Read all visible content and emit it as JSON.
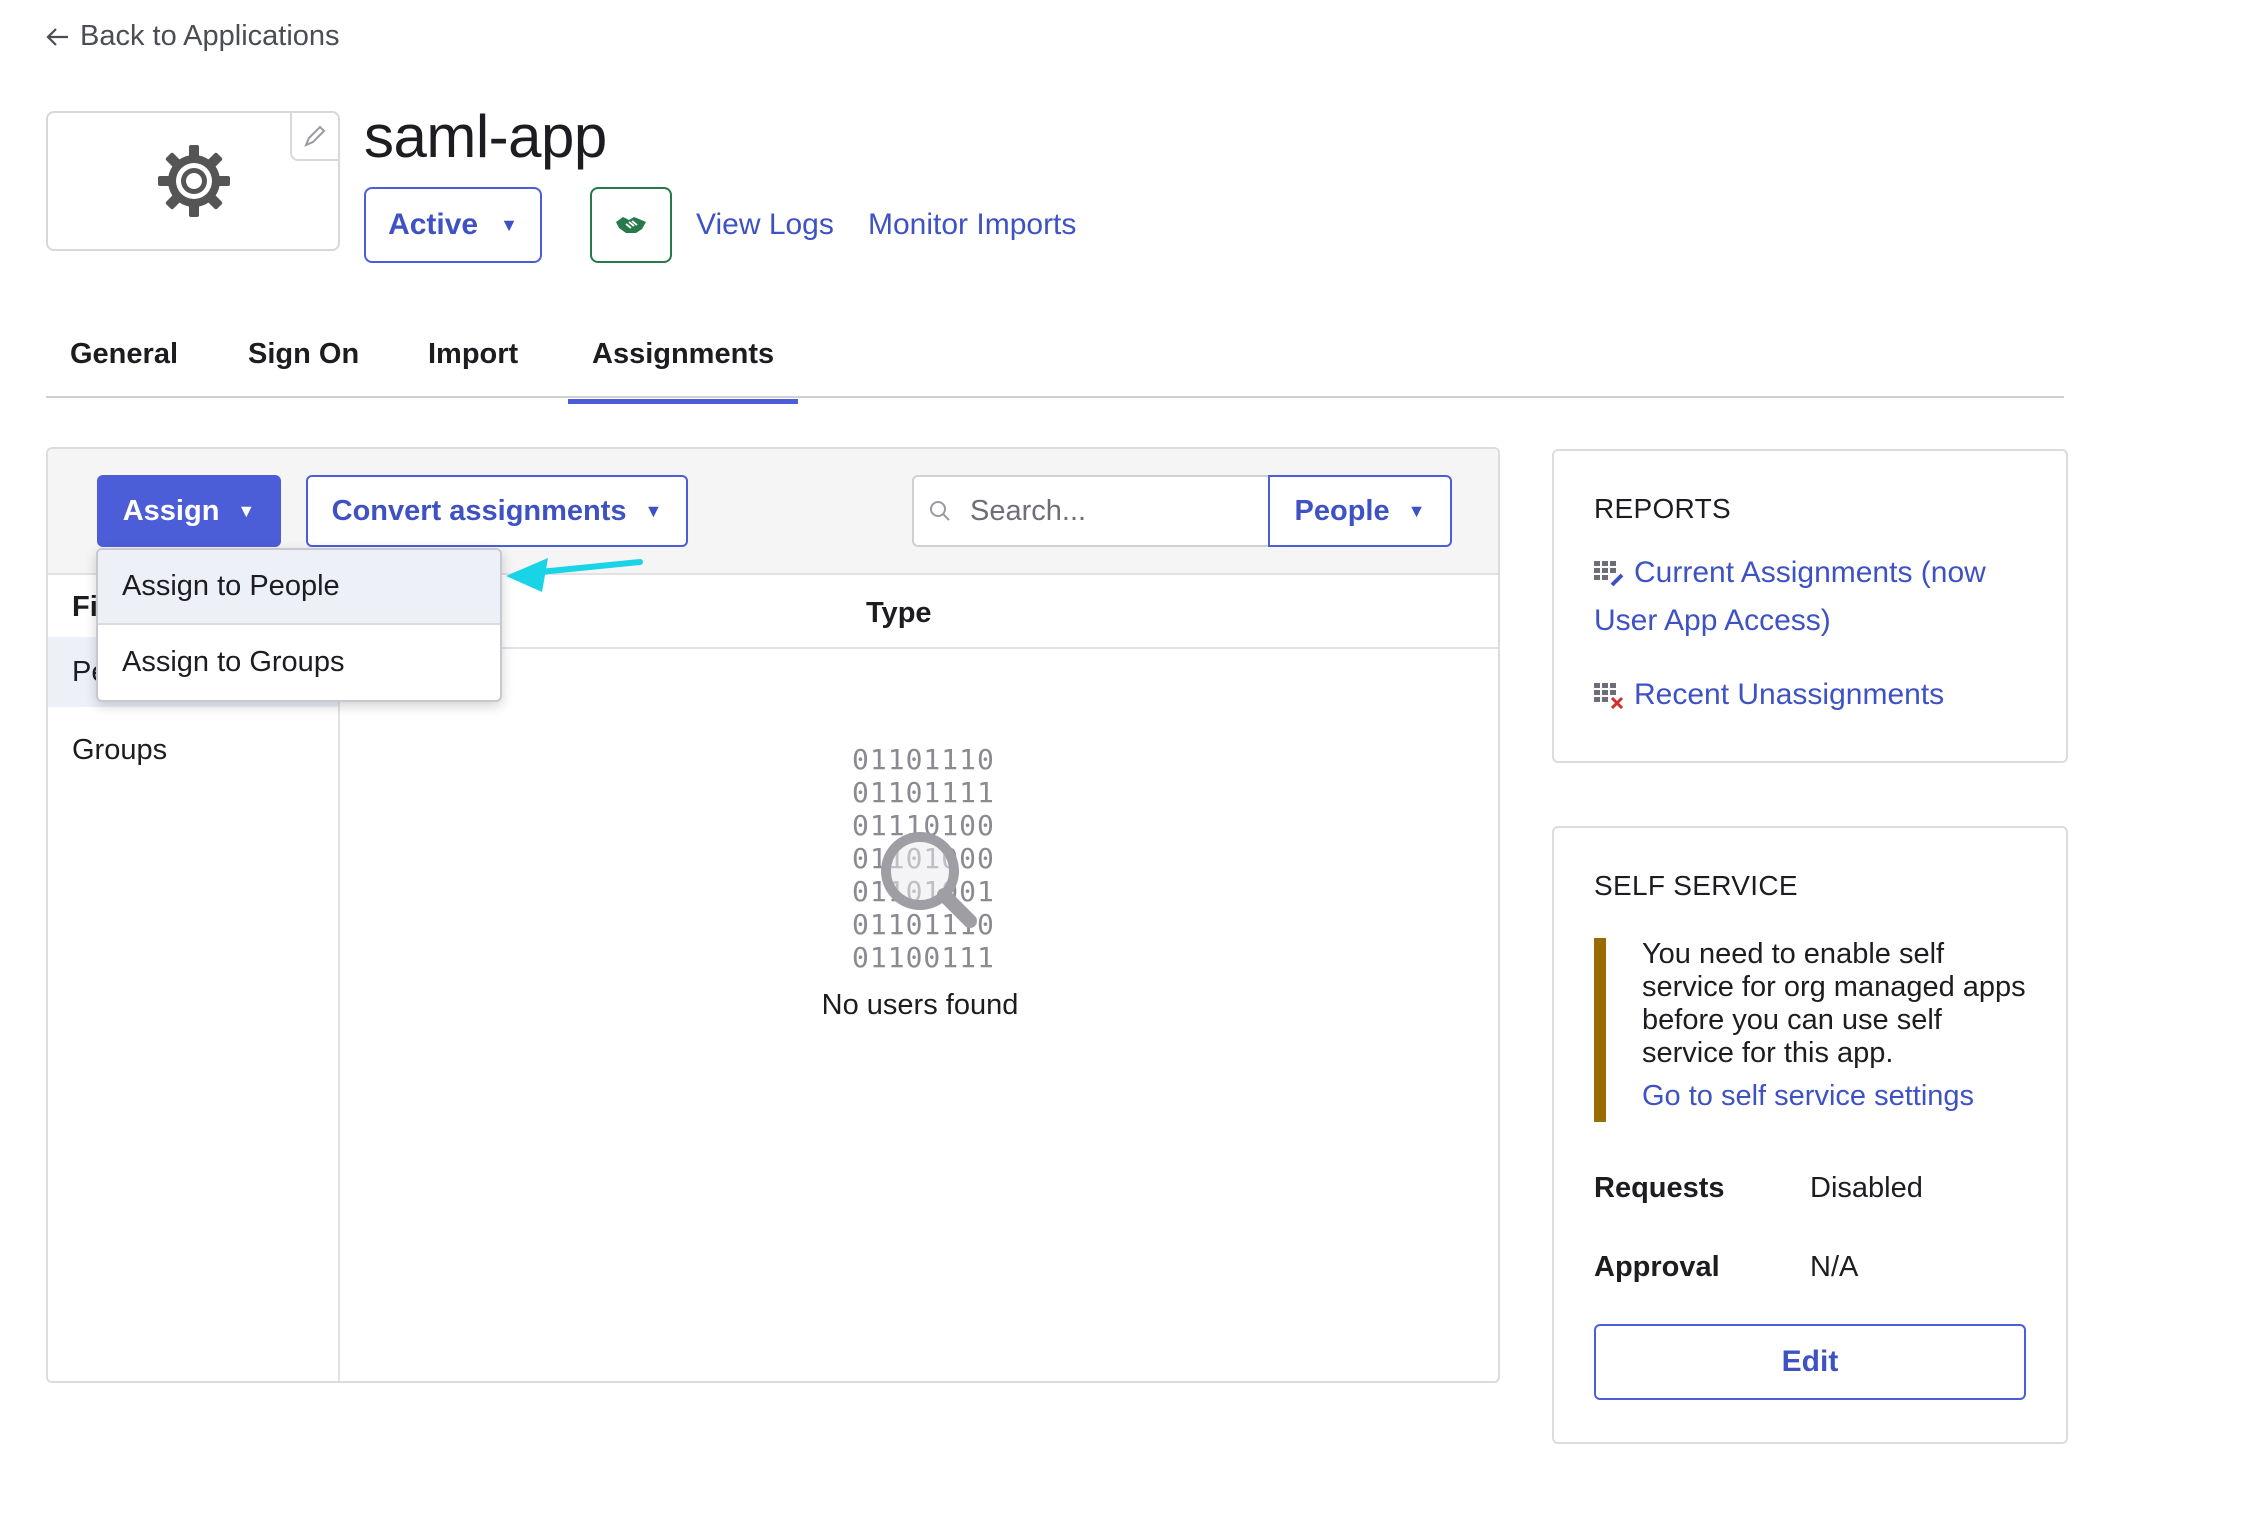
{
  "nav": {
    "back_label": "Back to Applications"
  },
  "app": {
    "title": "saml-app",
    "status_label": "Active",
    "view_logs": "View Logs",
    "monitor_imports": "Monitor Imports"
  },
  "tabs": [
    {
      "label": "General"
    },
    {
      "label": "Sign On"
    },
    {
      "label": "Import"
    },
    {
      "label": "Assignments",
      "active": true
    }
  ],
  "toolbar": {
    "assign_label": "Assign",
    "convert_label": "Convert assignments",
    "search_placeholder": "Search...",
    "people_label": "People"
  },
  "filters": {
    "heading": "Filters",
    "items": [
      {
        "label": "People"
      },
      {
        "label": "Groups"
      }
    ]
  },
  "table": {
    "type_header": "Type"
  },
  "empty_state": {
    "binary_lines": [
      "01101110",
      "01101111",
      "01110100",
      "01101000",
      "01101001",
      "01101110",
      "01100111"
    ],
    "message": "No users found"
  },
  "assign_menu": {
    "items": [
      {
        "label": "Assign to People"
      },
      {
        "label": "Assign to Groups"
      }
    ]
  },
  "reports": {
    "title": "REPORTS",
    "current_assignments_line1": "Current Assignments (now",
    "current_assignments_line2": "User App Access)",
    "recent_unassignments": "Recent Unassignments"
  },
  "self_service": {
    "title": "SELF SERVICE",
    "notice": "You need to enable self service for org managed apps before you can use self service for this app.",
    "settings_link": "Go to self service settings",
    "requests_label": "Requests",
    "requests_value": "Disabled",
    "approval_label": "Approval",
    "approval_value": "N/A",
    "edit_label": "Edit"
  },
  "colors": {
    "accent": "#4b5ed8",
    "link": "#3e52c4",
    "success": "#25794a",
    "warning_bar": "#9a6b00",
    "annotation_arrow": "#19d3e6"
  },
  "icons": [
    "arrow-left-icon",
    "gear-icon",
    "pencil-icon",
    "handshake-icon",
    "caret-down-icon",
    "search-icon",
    "magnifier-icon",
    "report-grid-icon",
    "report-grid-remove-icon"
  ]
}
